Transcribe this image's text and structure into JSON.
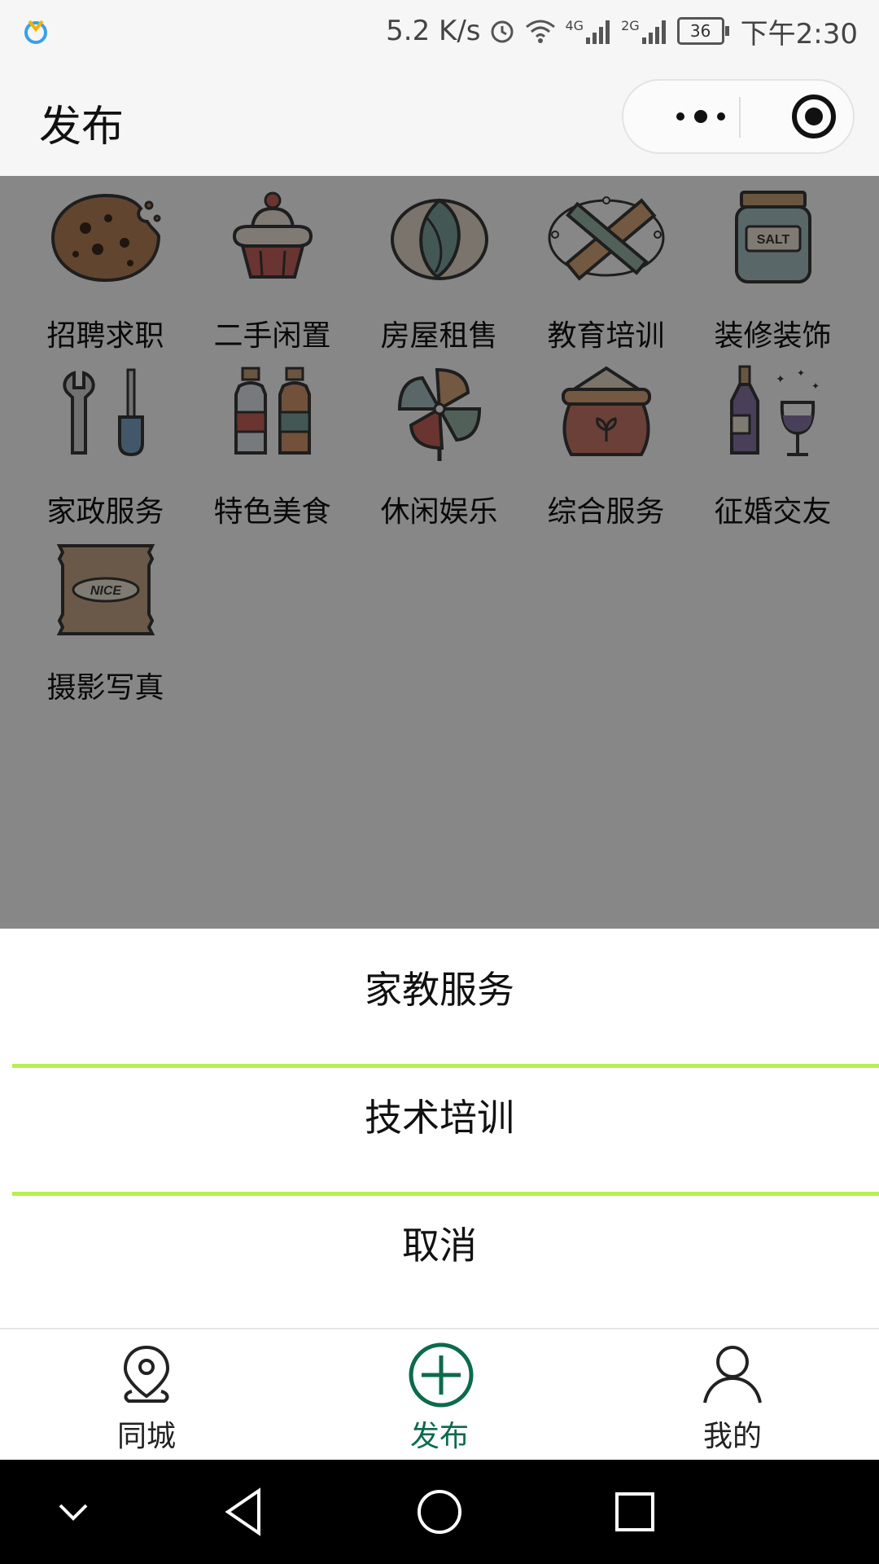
{
  "status_bar": {
    "speed": "5.2 K/s",
    "net1": "4G",
    "net2": "2G",
    "battery": "36",
    "time": "下午2:30"
  },
  "navbar": {
    "title": "发布",
    "more_icon": "more-dots-icon",
    "close_icon": "target-icon"
  },
  "categories": [
    {
      "label": "招聘求职",
      "icon": "cookie-icon"
    },
    {
      "label": "二手闲置",
      "icon": "cupcake-icon"
    },
    {
      "label": "房屋租售",
      "icon": "pistachio-icon"
    },
    {
      "label": "教育培训",
      "icon": "ruler-pencil-icon"
    },
    {
      "label": "装修装饰",
      "icon": "salt-jar-icon"
    },
    {
      "label": "家政服务",
      "icon": "tools-icon"
    },
    {
      "label": "特色美食",
      "icon": "bottles-icon"
    },
    {
      "label": "休闲娱乐",
      "icon": "pinwheel-icon"
    },
    {
      "label": "综合服务",
      "icon": "flour-sack-icon"
    },
    {
      "label": "征婚交友",
      "icon": "wine-icon"
    },
    {
      "label": "摄影写真",
      "icon": "snack-bag-icon"
    }
  ],
  "icon_text": {
    "salt": "SALT",
    "nice": "NICE"
  },
  "action_sheet": {
    "items": [
      "家教服务",
      "技术培训"
    ],
    "cancel": "取消",
    "divider_color": "#b8ef4e"
  },
  "tabbar": {
    "tabs": [
      {
        "label": "同城",
        "icon": "location-pin-icon",
        "active": false
      },
      {
        "label": "发布",
        "icon": "plus-circle-icon",
        "active": true
      },
      {
        "label": "我的",
        "icon": "user-icon",
        "active": false
      }
    ],
    "active_color": "#0b6b4a"
  },
  "colors": {
    "overlay": "rgba(0,0,0,0.47)"
  }
}
